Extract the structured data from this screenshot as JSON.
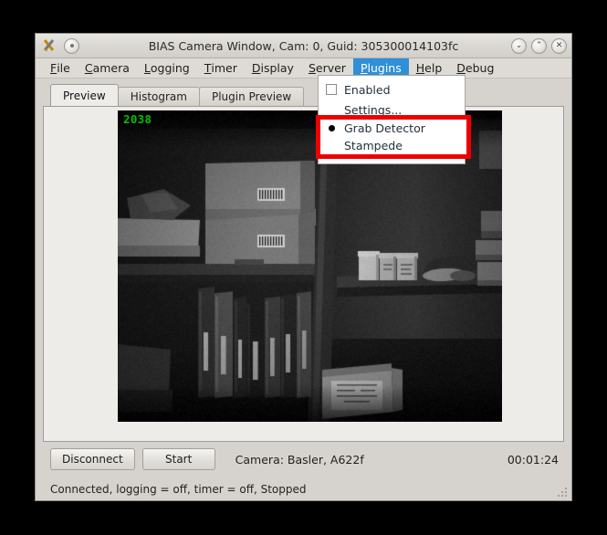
{
  "window": {
    "title": "BIAS Camera Window, Cam: 0, Guid: 305300014103fc",
    "app_icon": "bias-app-icon",
    "menu_button_icon": "window-menu-icon",
    "buttons": [
      {
        "name": "minimize-button",
        "glyph": "⌄"
      },
      {
        "name": "maximize-button",
        "glyph": "⌃"
      },
      {
        "name": "close-button",
        "glyph": "✕"
      }
    ]
  },
  "menubar": {
    "items": [
      {
        "label": "File",
        "mnemonic": "F",
        "rest": "ile",
        "active": false
      },
      {
        "label": "Camera",
        "mnemonic": "C",
        "rest": "amera",
        "active": false
      },
      {
        "label": "Logging",
        "mnemonic": "L",
        "rest": "ogging",
        "active": false
      },
      {
        "label": "Timer",
        "mnemonic": "T",
        "rest": "imer",
        "active": false
      },
      {
        "label": "Display",
        "mnemonic": "D",
        "rest": "isplay",
        "active": false
      },
      {
        "label": "Server",
        "mnemonic": "S",
        "rest": "erver",
        "active": false
      },
      {
        "label": "Plugins",
        "mnemonic": "P",
        "rest": "lugins",
        "active": true
      },
      {
        "label": "Help",
        "mnemonic": "H",
        "rest": "elp",
        "active": false
      },
      {
        "label": "Debug",
        "mnemonic": "D",
        "rest": "ebug",
        "active": false
      }
    ],
    "active_accent": "#2f8fd8"
  },
  "plugins_menu": {
    "open": true,
    "items": [
      {
        "label": "Enabled",
        "marker": "checkbox",
        "checked": false
      },
      {
        "label": "Settings...",
        "marker": "none",
        "checked": false
      }
    ],
    "highlighted_group": {
      "highlight_color": "#ee0000",
      "items": [
        {
          "label": "Grab Detector",
          "marker": "radio",
          "selected": true
        },
        {
          "label": "Stampede",
          "marker": "none",
          "selected": false
        }
      ]
    }
  },
  "tabs": [
    {
      "label": "Preview",
      "selected": true
    },
    {
      "label": "Histogram",
      "selected": false
    },
    {
      "label": "Plugin Preview",
      "selected": false
    }
  ],
  "preview": {
    "frame_counter": "2038",
    "frame_counter_color": "#00c000",
    "scene_description": "grayscale camera view of storage shelves with cardboard boxes, binders and containers"
  },
  "controls": {
    "disconnect_label": "Disconnect",
    "start_label": "Start",
    "camera_info": "Camera:  Basler,  A622f",
    "elapsed_time": "00:01:24"
  },
  "statusbar": {
    "text": "Connected, logging = off, timer = off, Stopped",
    "resize_grip_icon": "resize-grip-icon"
  }
}
